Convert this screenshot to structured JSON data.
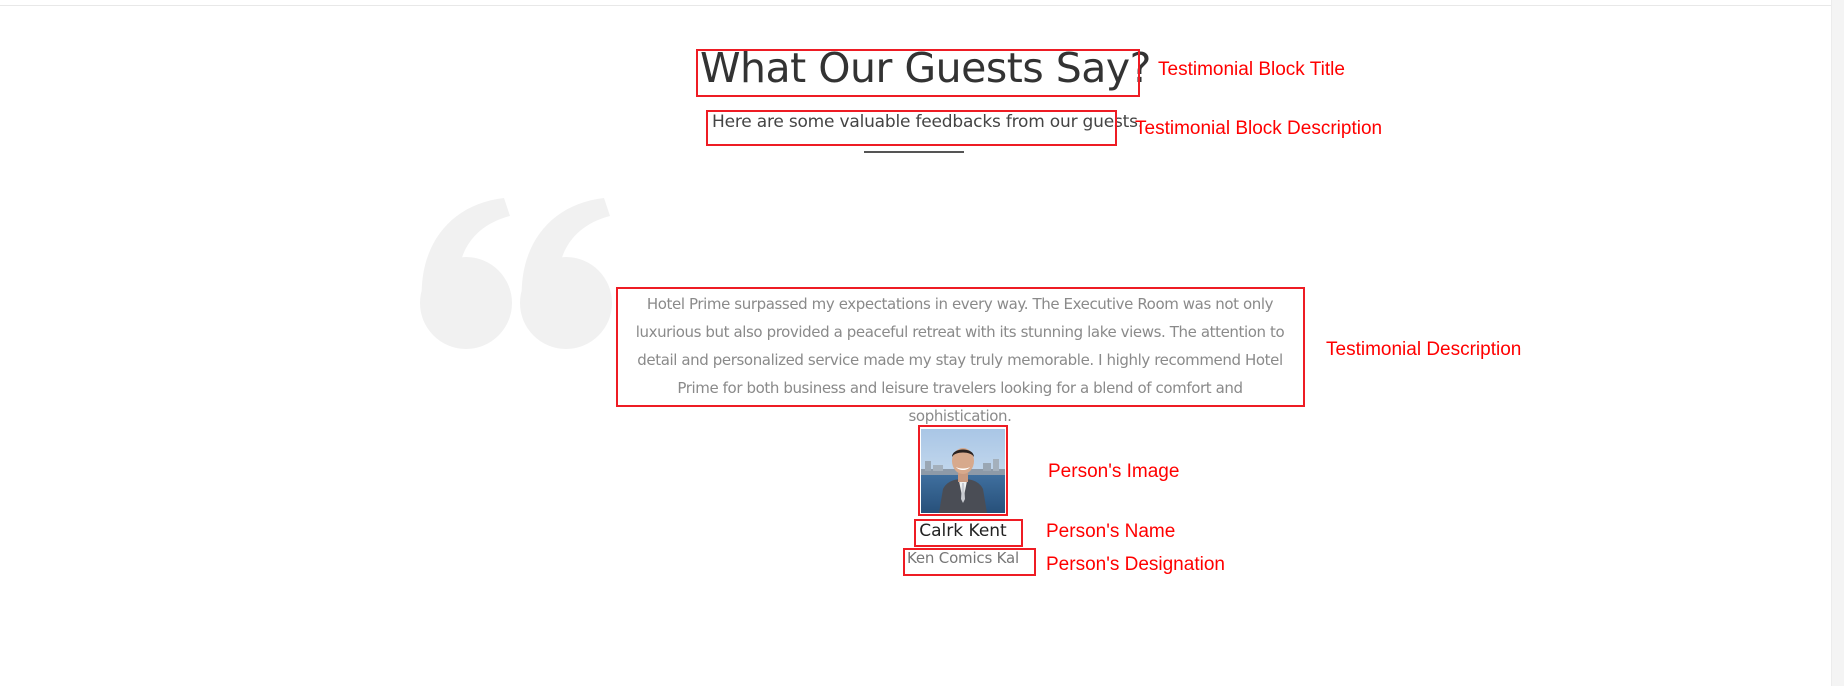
{
  "testimonial_block": {
    "title": "What Our Guests Say?",
    "description": "Here are some valuable feedbacks from our guests."
  },
  "testimonial": {
    "quote_icon": "quote-icon",
    "lines": [
      "Hotel Prime surpassed my expectations in every way. The Executive Room was not only",
      "luxurious but also provided a peaceful retreat with its stunning lake views. The attention to",
      "detail and personalized service made my stay truly memorable. I highly recommend Hotel",
      "Prime for both business and leisure travelers looking for a blend of comfort and sophistication."
    ],
    "person": {
      "name": "Calrk Kent",
      "designation": "Ken Comics Kal"
    }
  },
  "annotations": {
    "title_label": "Testimonial Block Title",
    "description_label": "Testimonial Block Description",
    "testimonial_description_label": "Testimonial Description",
    "image_label": "Person's Image",
    "name_label": "Person's Name",
    "designation_label": "Person's Designation"
  },
  "colors": {
    "annotation": "#ff0000",
    "quote_mark": "#f1f1f1",
    "title_text": "#333333",
    "testimonial_text": "#8a8a8a"
  }
}
